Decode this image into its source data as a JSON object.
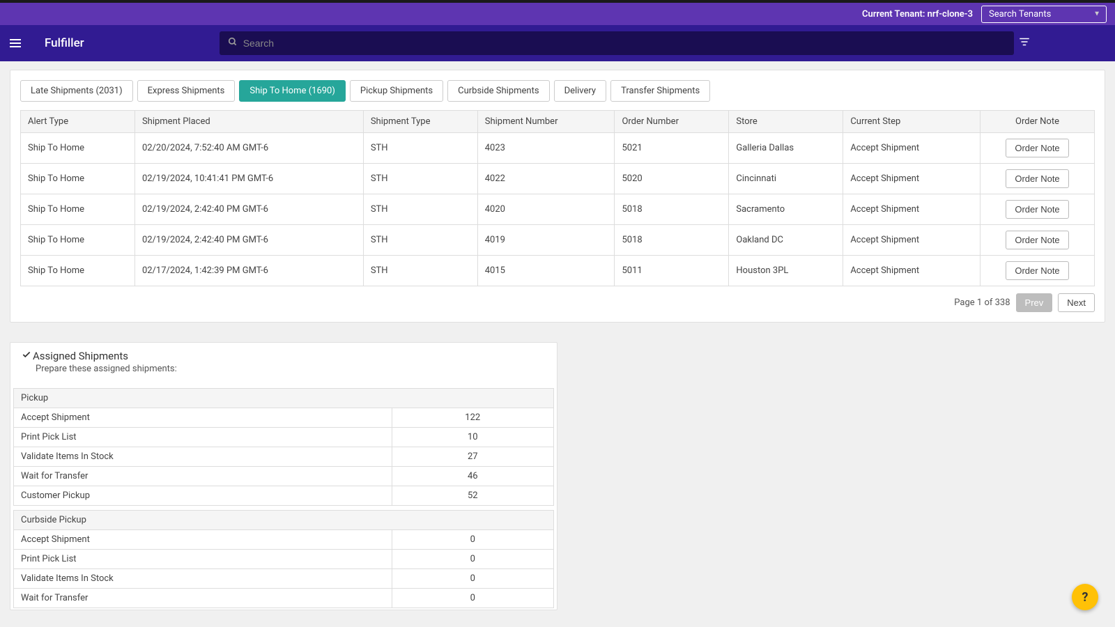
{
  "tenantBar": {
    "label": "Current Tenant: nrf-clone-3",
    "selectPlaceholder": "Search Tenants"
  },
  "header": {
    "appTitle": "Fulfiller",
    "searchPlaceholder": "Search"
  },
  "tabs": [
    {
      "label": "Late Shipments (2031)",
      "active": false
    },
    {
      "label": "Express Shipments",
      "active": false
    },
    {
      "label": "Ship To Home (1690)",
      "active": true
    },
    {
      "label": "Pickup Shipments",
      "active": false
    },
    {
      "label": "Curbside Shipments",
      "active": false
    },
    {
      "label": "Delivery",
      "active": false
    },
    {
      "label": "Transfer Shipments",
      "active": false
    }
  ],
  "table": {
    "headers": [
      "Alert Type",
      "Shipment Placed",
      "Shipment Type",
      "Shipment Number",
      "Order Number",
      "Store",
      "Current Step",
      "Order Note"
    ],
    "rows": [
      {
        "alertType": "Ship To Home",
        "placed": "02/20/2024, 7:52:40 AM GMT-6",
        "type": "STH",
        "num": "4023",
        "order": "5021",
        "store": "Galleria Dallas",
        "step": "Accept Shipment",
        "noteBtn": "Order Note"
      },
      {
        "alertType": "Ship To Home",
        "placed": "02/19/2024, 10:41:41 PM GMT-6",
        "type": "STH",
        "num": "4022",
        "order": "5020",
        "store": "Cincinnati",
        "step": "Accept Shipment",
        "noteBtn": "Order Note"
      },
      {
        "alertType": "Ship To Home",
        "placed": "02/19/2024, 2:42:40 PM GMT-6",
        "type": "STH",
        "num": "4020",
        "order": "5018",
        "store": "Sacramento",
        "step": "Accept Shipment",
        "noteBtn": "Order Note"
      },
      {
        "alertType": "Ship To Home",
        "placed": "02/19/2024, 2:42:40 PM GMT-6",
        "type": "STH",
        "num": "4019",
        "order": "5018",
        "store": "Oakland DC",
        "step": "Accept Shipment",
        "noteBtn": "Order Note"
      },
      {
        "alertType": "Ship To Home",
        "placed": "02/17/2024, 1:42:39 PM GMT-6",
        "type": "STH",
        "num": "4015",
        "order": "5011",
        "store": "Houston 3PL",
        "step": "Accept Shipment",
        "noteBtn": "Order Note"
      }
    ]
  },
  "pager": {
    "pageText": "Page 1 of 338",
    "prev": "Prev",
    "next": "Next"
  },
  "assigned": {
    "title": "Assigned Shipments",
    "subtitle": "Prepare these assigned shipments:",
    "sections": [
      {
        "name": "Pickup",
        "rows": [
          {
            "step": "Accept Shipment",
            "count": "122"
          },
          {
            "step": "Print Pick List",
            "count": "10"
          },
          {
            "step": "Validate Items In Stock",
            "count": "27"
          },
          {
            "step": "Wait for Transfer",
            "count": "46"
          },
          {
            "step": "Customer Pickup",
            "count": "52"
          }
        ]
      },
      {
        "name": "Curbside Pickup",
        "rows": [
          {
            "step": "Accept Shipment",
            "count": "0"
          },
          {
            "step": "Print Pick List",
            "count": "0"
          },
          {
            "step": "Validate Items In Stock",
            "count": "0"
          },
          {
            "step": "Wait for Transfer",
            "count": "0"
          }
        ]
      }
    ]
  },
  "help": "?"
}
